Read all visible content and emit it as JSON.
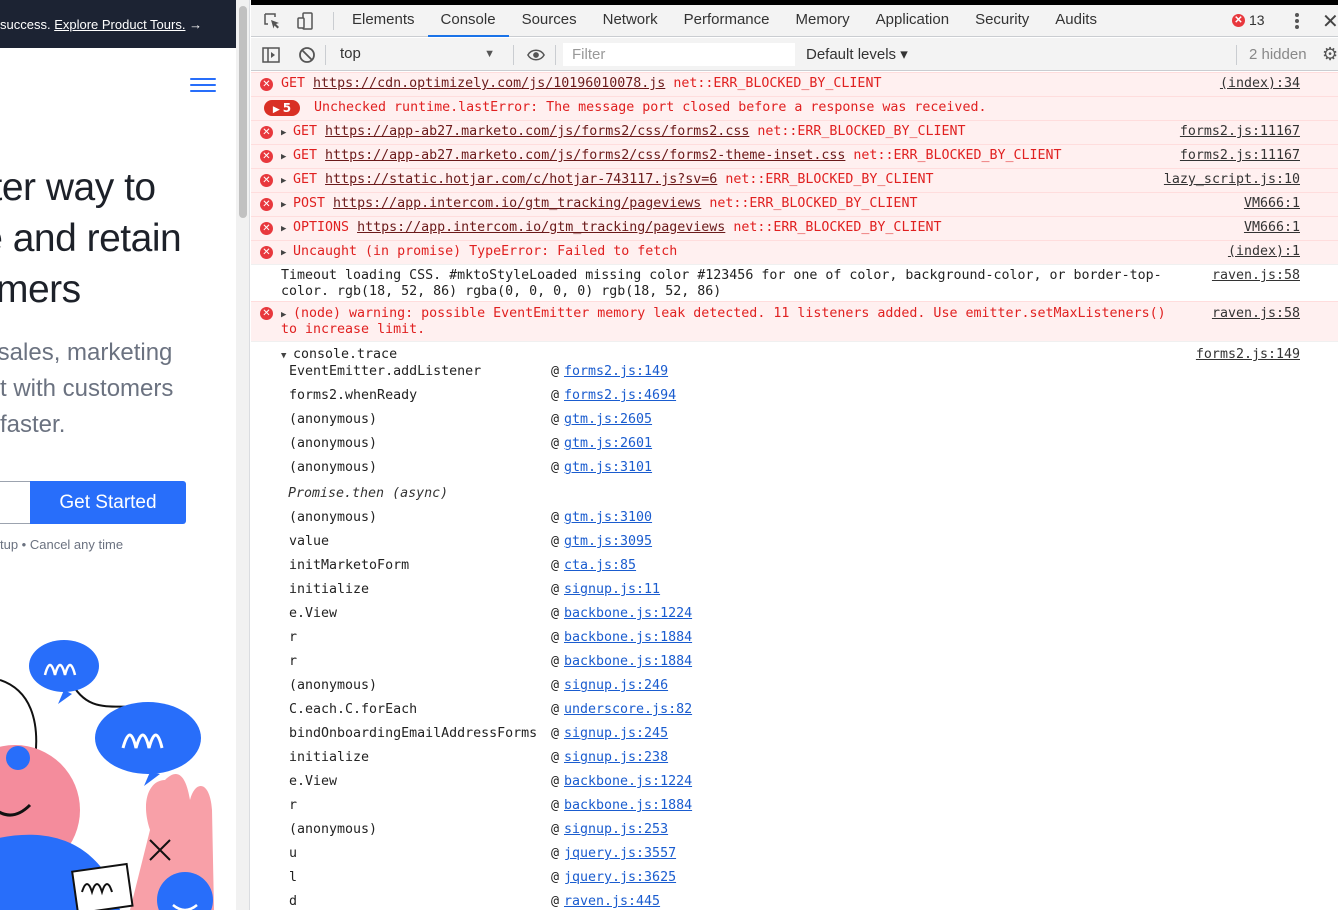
{
  "page": {
    "banner_text": "success. ",
    "banner_link": "Explore Product Tours.",
    "banner_arrow": "→",
    "hero_lines": [
      "etter way to",
      "ge and retain",
      "mers"
    ],
    "sub_lines": [
      "r sales, marketing",
      "ct with customers",
      "faster."
    ],
    "cta_label": "Get Started",
    "small_note": "tup  •  Cancel any time"
  },
  "devtools": {
    "tabs": [
      "Elements",
      "Console",
      "Sources",
      "Network",
      "Performance",
      "Memory",
      "Application",
      "Security",
      "Audits"
    ],
    "active_tab": "Console",
    "error_count": "13",
    "toolbar": {
      "context": "top",
      "filter_placeholder": "Filter",
      "levels": "Default levels ▾",
      "hidden": "2 hidden"
    },
    "messages": [
      {
        "method": "GET",
        "url": "https://cdn.optimizely.com/js/10196010078.js",
        "error": "net::ERR_BLOCKED_BY_CLIENT",
        "source": "(index):34"
      },
      {
        "badge": "5",
        "text": "Unchecked runtime.lastError: The message port closed before a response was received."
      },
      {
        "method": "GET",
        "url": "https://app-ab27.marketo.com/js/forms2/css/forms2.css",
        "error": "net::ERR_BLOCKED_BY_CLIENT",
        "source": "forms2.js:11167"
      },
      {
        "method": "GET",
        "url": "https://app-ab27.marketo.com/js/forms2/css/forms2-theme-inset.css",
        "error": "net::ERR_BLOCKED_BY_CLIENT",
        "source": "forms2.js:11167"
      },
      {
        "method": "GET",
        "url": "https://static.hotjar.com/c/hotjar-743117.js?sv=6",
        "error": "net::ERR_BLOCKED_BY_CLIENT",
        "source": "lazy_script.js:10"
      },
      {
        "method": "POST",
        "url": "https://app.intercom.io/gtm_tracking/pageviews",
        "error": "net::ERR_BLOCKED_BY_CLIENT",
        "source": "VM666:1"
      },
      {
        "method": "OPTIONS",
        "url": "https://app.intercom.io/gtm_tracking/pageviews",
        "error": "net::ERR_BLOCKED_BY_CLIENT",
        "source": "VM666:1"
      },
      {
        "text": "Uncaught (in promise) TypeError: Failed to fetch",
        "source": "(index):1"
      }
    ],
    "timeout_lines": [
      "Timeout loading CSS. #mktoStyleLoaded missing color #123456 for one of color, background-color, or border-top-",
      "color. rgb(18, 52, 86) rgba(0, 0, 0, 0) rgb(18, 52, 86)"
    ],
    "timeout_source": "raven.js:58",
    "warning_lines": [
      "(node) warning: possible EventEmitter memory leak detected. 11 listeners added. Use emitter.setMaxListeners()",
      "to increase limit."
    ],
    "warning_source": "raven.js:58",
    "trace_header": "console.trace",
    "trace_source": "forms2.js:149",
    "trace_frames_a": [
      {
        "fn": "EventEmitter.addListener",
        "link": "forms2.js:149"
      },
      {
        "fn": "forms2.whenReady",
        "link": "forms2.js:4694"
      },
      {
        "fn": "(anonymous)",
        "link": "gtm.js:2605"
      },
      {
        "fn": "(anonymous)",
        "link": "gtm.js:2601"
      },
      {
        "fn": "(anonymous)",
        "link": "gtm.js:3101"
      }
    ],
    "async_label": "Promise.then (async)",
    "trace_frames_b": [
      {
        "fn": "(anonymous)",
        "link": "gtm.js:3100"
      },
      {
        "fn": "value",
        "link": "gtm.js:3095"
      },
      {
        "fn": "initMarketoForm",
        "link": "cta.js:85"
      },
      {
        "fn": "initialize",
        "link": "signup.js:11"
      },
      {
        "fn": "e.View",
        "link": "backbone.js:1224"
      },
      {
        "fn": "r",
        "link": "backbone.js:1884"
      },
      {
        "fn": "r",
        "link": "backbone.js:1884"
      },
      {
        "fn": "(anonymous)",
        "link": "signup.js:246"
      },
      {
        "fn": "C.each.C.forEach",
        "link": "underscore.js:82"
      },
      {
        "fn": "bindOnboardingEmailAddressForms",
        "link": "signup.js:245"
      },
      {
        "fn": "initialize",
        "link": "signup.js:238"
      },
      {
        "fn": "e.View",
        "link": "backbone.js:1224"
      },
      {
        "fn": "r",
        "link": "backbone.js:1884"
      },
      {
        "fn": "(anonymous)",
        "link": "signup.js:253"
      },
      {
        "fn": "u",
        "link": "jquery.js:3557"
      },
      {
        "fn": "l",
        "link": "jquery.js:3625"
      },
      {
        "fn": "d",
        "link": "raven.js:445"
      }
    ]
  }
}
